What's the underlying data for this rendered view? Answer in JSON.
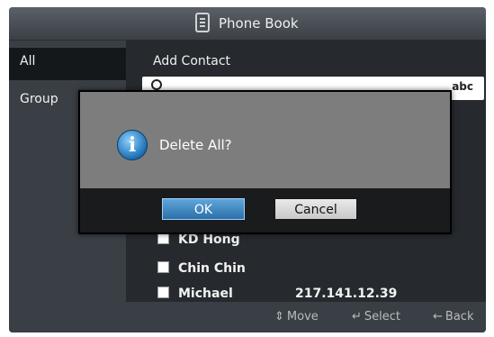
{
  "window": {
    "title": "Phone Book"
  },
  "sidebar": {
    "items": [
      {
        "label": "All"
      },
      {
        "label": "Group"
      }
    ]
  },
  "main": {
    "add_contact_label": "Add Contact",
    "search_value": "",
    "search_mode": "abc",
    "contacts": [
      {
        "name": "KD Hong",
        "ip": ""
      },
      {
        "name": "Chin Chin",
        "ip": ""
      },
      {
        "name": "Michael",
        "ip": "217.141.12.39"
      }
    ]
  },
  "dialog": {
    "message": "Delete All?",
    "ok_label": "OK",
    "cancel_label": "Cancel",
    "icon": "info-icon"
  },
  "footer": {
    "move": "Move",
    "select": "Select",
    "back": "Back"
  },
  "colors": {
    "accent": "#3b82c4",
    "background": "#1f2226"
  }
}
